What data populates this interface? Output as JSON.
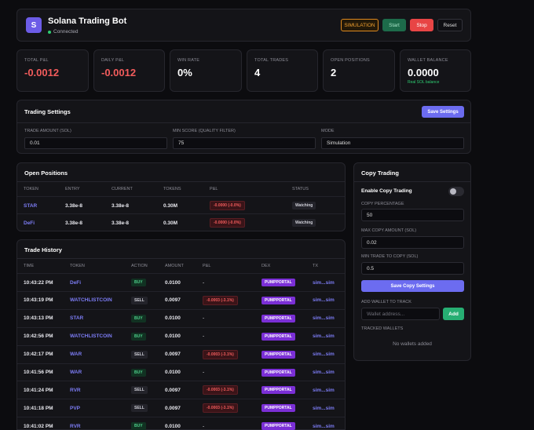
{
  "header": {
    "logo_letter": "S",
    "title": "Solana Trading Bot",
    "status": "Connected",
    "buttons": {
      "simulation": "SIMULATION",
      "start": "Start",
      "stop": "Stop",
      "reset": "Reset"
    }
  },
  "stats": [
    {
      "label": "TOTAL P&L",
      "value": "-0.0012",
      "tone": "neg"
    },
    {
      "label": "DAILY P&L",
      "value": "-0.0012",
      "tone": "neg"
    },
    {
      "label": "WIN RATE",
      "value": "0%",
      "tone": ""
    },
    {
      "label": "TOTAL TRADES",
      "value": "4",
      "tone": ""
    },
    {
      "label": "OPEN POSITIONS",
      "value": "2",
      "tone": ""
    },
    {
      "label": "WALLET BALANCE",
      "value": "0.0000",
      "tone": "",
      "sub": "Real SOL balance"
    }
  ],
  "trading_settings": {
    "title": "Trading Settings",
    "save_label": "Save Settings",
    "fields": [
      {
        "label": "TRADE AMOUNT (SOL)",
        "value": "0.01"
      },
      {
        "label": "MIN SCORE (QUALITY FILTER)",
        "value": "75"
      },
      {
        "label": "MODE",
        "value": "Simulation"
      }
    ]
  },
  "open_positions": {
    "title": "Open Positions",
    "columns": [
      "TOKEN",
      "ENTRY",
      "CURRENT",
      "TOKENS",
      "P&L",
      "STATUS"
    ],
    "rows": [
      {
        "token": "STAR",
        "entry": "3.38e-8",
        "current": "3.38e-8",
        "tokens": "0.30M",
        "pnl": "-0.0000 (-0.0%)",
        "status": "Watching"
      },
      {
        "token": "DeFi",
        "entry": "3.38e-8",
        "current": "3.38e-8",
        "tokens": "0.30M",
        "pnl": "-0.0000 (-0.0%)",
        "status": "Watching"
      }
    ]
  },
  "trade_history": {
    "title": "Trade History",
    "columns": [
      "TIME",
      "TOKEN",
      "ACTION",
      "AMOUNT",
      "P&L",
      "DEX",
      "TX"
    ],
    "rows": [
      {
        "time": "10:43:22 PM",
        "token": "DeFi",
        "action": "BUY",
        "amount": "0.0100",
        "pnl": "-",
        "dex": "PUMPPORTAL",
        "tx": "sim...sim"
      },
      {
        "time": "10:43:19 PM",
        "token": "WATCHLISTCOIN",
        "action": "SELL",
        "amount": "0.0097",
        "pnl": "-0.0003 (-3.1%)",
        "dex": "PUMPPORTAL",
        "tx": "sim...sim"
      },
      {
        "time": "10:43:13 PM",
        "token": "STAR",
        "action": "BUY",
        "amount": "0.0100",
        "pnl": "-",
        "dex": "PUMPPORTAL",
        "tx": "sim...sim"
      },
      {
        "time": "10:42:56 PM",
        "token": "WATCHLISTCOIN",
        "action": "BUY",
        "amount": "0.0100",
        "pnl": "-",
        "dex": "PUMPPORTAL",
        "tx": "sim...sim"
      },
      {
        "time": "10:42:17 PM",
        "token": "WAR",
        "action": "SELL",
        "amount": "0.0097",
        "pnl": "-0.0003 (-3.1%)",
        "dex": "PUMPPORTAL",
        "tx": "sim...sim"
      },
      {
        "time": "10:41:56 PM",
        "token": "WAR",
        "action": "BUY",
        "amount": "0.0100",
        "pnl": "-",
        "dex": "PUMPPORTAL",
        "tx": "sim...sim"
      },
      {
        "time": "10:41:24 PM",
        "token": "RVR",
        "action": "SELL",
        "amount": "0.0097",
        "pnl": "-0.0003 (-3.1%)",
        "dex": "PUMPPORTAL",
        "tx": "sim...sim"
      },
      {
        "time": "10:41:18 PM",
        "token": "PVP",
        "action": "SELL",
        "amount": "0.0097",
        "pnl": "-0.0003 (-3.1%)",
        "dex": "PUMPPORTAL",
        "tx": "sim...sim"
      },
      {
        "time": "10:41:02 PM",
        "token": "RVR",
        "action": "BUY",
        "amount": "0.0100",
        "pnl": "-",
        "dex": "PUMPPORTAL",
        "tx": "sim...sim"
      }
    ]
  },
  "copy_trading": {
    "title": "Copy Trading",
    "enable_label": "Enable Copy Trading",
    "enabled": false,
    "copy_pct_label": "COPY PERCENTAGE",
    "copy_pct_value": "50",
    "max_copy_label": "MAX COPY AMOUNT (SOL)",
    "max_copy_value": "0.02",
    "min_trade_label": "MIN TRADE TO COPY (SOL)",
    "min_trade_value": "0.5",
    "save_label": "Save Copy Settings",
    "add_wallet_label": "ADD WALLET TO TRACK",
    "wallet_placeholder": "Wallet address...",
    "add_label": "Add",
    "tracked_label": "TRACKED WALLETS",
    "empty_text": "No wallets added"
  },
  "colors": {
    "accent": "#6c6cf0",
    "loss": "#f25c5c",
    "success": "#2ecc71",
    "dex": "#7b2fd6"
  }
}
